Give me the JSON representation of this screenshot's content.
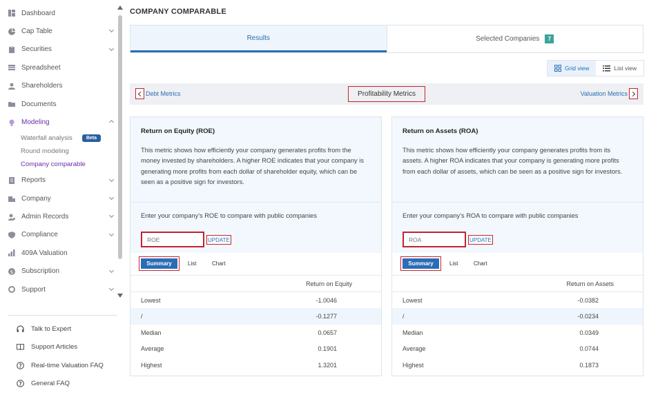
{
  "sidebar": {
    "items": [
      {
        "label": "Dashboard",
        "icon": "dashboard-icon",
        "chevron": ""
      },
      {
        "label": "Cap Table",
        "icon": "pie-chart-icon",
        "chevron": "down"
      },
      {
        "label": "Securities",
        "icon": "clipboard-icon",
        "chevron": "down"
      },
      {
        "label": "Spreadsheet",
        "icon": "spreadsheet-icon",
        "chevron": ""
      },
      {
        "label": "Shareholders",
        "icon": "person-icon",
        "chevron": ""
      },
      {
        "label": "Documents",
        "icon": "folder-icon",
        "chevron": ""
      },
      {
        "label": "Modeling",
        "icon": "lightbulb-icon",
        "chevron": "up"
      }
    ],
    "modeling_sub": [
      {
        "label": "Waterfall analysis",
        "badge": "Beta"
      },
      {
        "label": "Round modeling",
        "badge": ""
      },
      {
        "label": "Company comparable",
        "badge": ""
      }
    ],
    "items2": [
      {
        "label": "Reports",
        "icon": "report-icon",
        "chevron": "down"
      },
      {
        "label": "Company",
        "icon": "building-icon",
        "chevron": "down"
      },
      {
        "label": "Admin Records",
        "icon": "admin-icon",
        "chevron": "down"
      },
      {
        "label": "Compliance",
        "icon": "shield-icon",
        "chevron": "down"
      },
      {
        "label": "409A Valuation",
        "icon": "bar-chart-icon",
        "chevron": ""
      },
      {
        "label": "Subscription",
        "icon": "dollar-icon",
        "chevron": "down"
      },
      {
        "label": "Support",
        "icon": "support-icon",
        "chevron": "down"
      }
    ],
    "footer": [
      {
        "label": "Talk to Expert",
        "icon": "headset-icon"
      },
      {
        "label": "Support Articles",
        "icon": "book-icon"
      },
      {
        "label": "Real-time Valuation FAQ",
        "icon": "help-circle-icon"
      },
      {
        "label": "General FAQ",
        "icon": "help-circle-icon"
      }
    ]
  },
  "page": {
    "title": "COMPANY COMPARABLE"
  },
  "tabs": {
    "results": "Results",
    "selected": "Selected Companies",
    "selected_count": "7"
  },
  "view_toggle": {
    "grid": "Grid view",
    "list": "List view"
  },
  "metric_nav": {
    "prev": "Debt Metrics",
    "current": "Profitability Metrics",
    "next": "Valuation Metrics"
  },
  "cards": [
    {
      "title": "Return on Equity (ROE)",
      "description": "This metric shows how efficiently your company generates profits from the money invested by shareholders. A higher ROE indicates that your company is generating more profits from each dollar of shareholder equity, which can be seen as a positive sign for investors.",
      "input_label": "Enter your company's ROE to compare with public companies",
      "placeholder": "ROE",
      "update": "UPDATE",
      "subtabs": {
        "summary": "Summary",
        "list": "List",
        "chart": "Chart"
      },
      "column": "Return on Equity",
      "rows": [
        {
          "label": "Lowest",
          "value": "-1.0046"
        },
        {
          "label": "/",
          "value": "-0.1277"
        },
        {
          "label": "Median",
          "value": "0.0657"
        },
        {
          "label": "Average",
          "value": "0.1901"
        },
        {
          "label": "Highest",
          "value": "1.3201"
        }
      ]
    },
    {
      "title": "Return on Assets (ROA)",
      "description": "This metric shows how efficiently your company generates profits from its assets. A higher ROA indicates that your company is generating more profits from each dollar of assets, which can be seen as a positive sign for investors.",
      "input_label": "Enter your company's ROA to compare with public companies",
      "placeholder": "ROA",
      "update": "UPDATE",
      "subtabs": {
        "summary": "Summary",
        "list": "List",
        "chart": "Chart"
      },
      "column": "Return on Assets",
      "rows": [
        {
          "label": "Lowest",
          "value": "-0.0382"
        },
        {
          "label": "/",
          "value": "-0.0234"
        },
        {
          "label": "Median",
          "value": "0.0349"
        },
        {
          "label": "Average",
          "value": "0.0744"
        },
        {
          "label": "Highest",
          "value": "0.1873"
        }
      ]
    }
  ],
  "colors": {
    "accent": "#2a6db5",
    "modeling": "#6a2ca8",
    "highlight": "#c6202e",
    "badge": "#3aa39a"
  }
}
